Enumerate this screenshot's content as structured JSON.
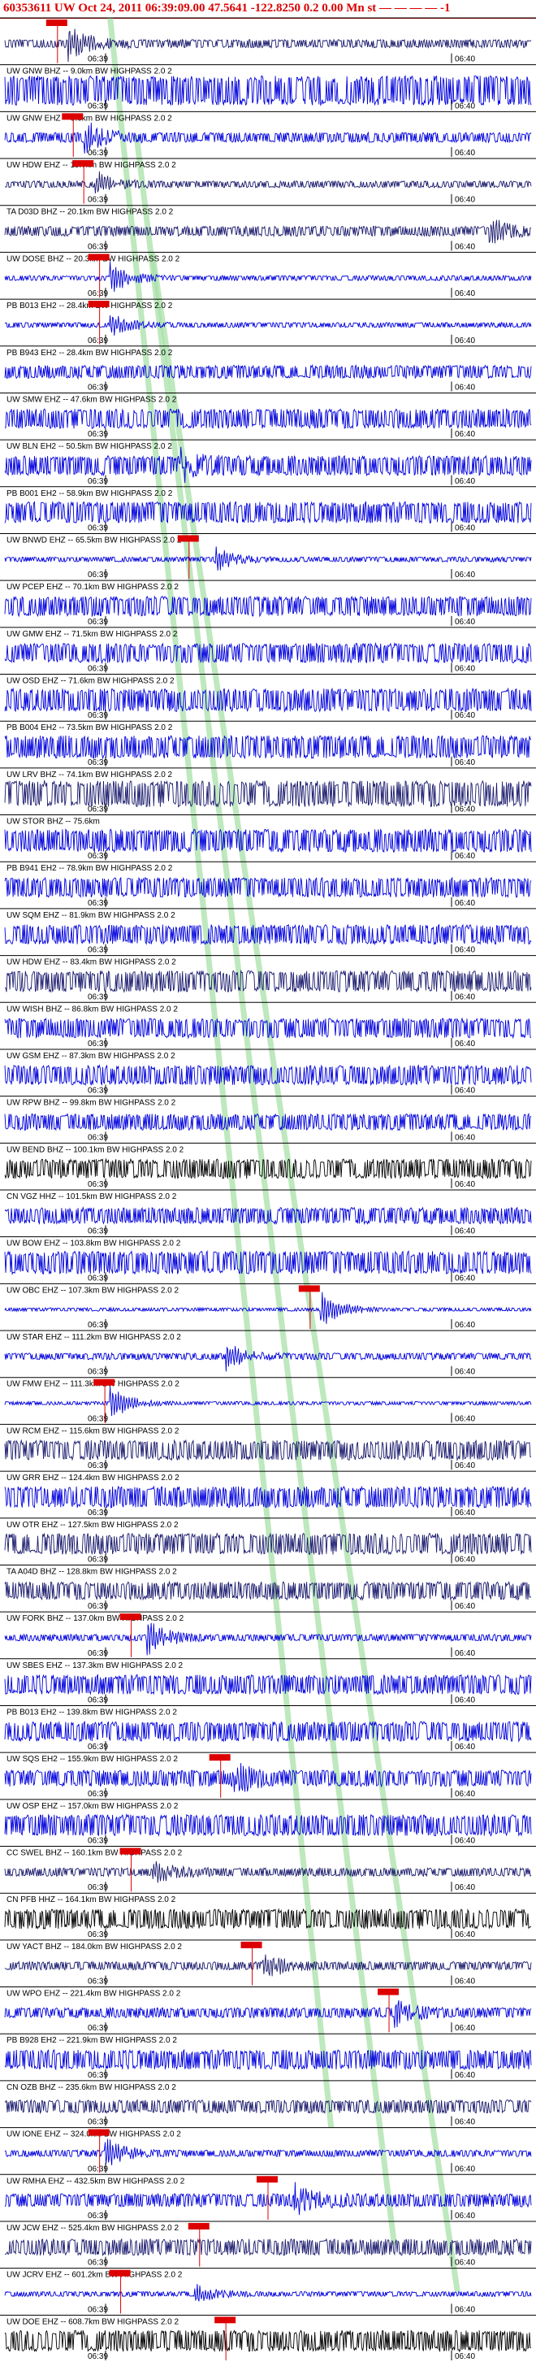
{
  "header": {
    "title": "60353611 UW Oct 24, 2011 06:39:09.00   47.5641 -122.8250   0.2 0.00 Mn st — — — — -1"
  },
  "time_labels": {
    "start": "06:39",
    "end": "06:40"
  },
  "colors": {
    "blue": "#0000dd",
    "navy": "#1a1a6e",
    "black": "#000000",
    "pick": "#dd0000",
    "phase": "#a8e0a8"
  },
  "stations": [
    {
      "label": "",
      "color": "navy",
      "amp": 5,
      "pick": 0.1,
      "event": 0.12,
      "evAmp": 20
    },
    {
      "label": "UW GNW BHZ -- 9.0km BW  HIGHPASS  2.0  2",
      "color": "blue",
      "amp": 18,
      "pick": null,
      "event": null,
      "evAmp": 0
    },
    {
      "label": "UW GNW EHZ -- 9.0km BW  HIGHPASS  2.0  2",
      "color": "blue",
      "amp": 6,
      "pick": 0.13,
      "event": 0.15,
      "evAmp": 18
    },
    {
      "label": "UW HDW EHZ -- 19.7km BW  HIGHPASS  2.0  2",
      "color": "navy",
      "amp": 4,
      "pick": 0.15,
      "event": 0.17,
      "evAmp": 16
    },
    {
      "label": "TA D03D BHZ -- 20.1km BW  HIGHPASS  2.0  2",
      "color": "navy",
      "amp": 6,
      "pick": null,
      "event": 0.92,
      "evAmp": 14
    },
    {
      "label": "UW DOSE BHZ -- 20.3km BW  HIGHPASS  2.0  2",
      "color": "blue",
      "amp": 3,
      "pick": 0.18,
      "event": 0.2,
      "evAmp": 18
    },
    {
      "label": "PB B013 EH2 -- 28.4km BW  HIGHPASS  2.0  2",
      "color": "blue",
      "amp": 3,
      "pick": 0.18,
      "event": 0.2,
      "evAmp": 14
    },
    {
      "label": "PB B943 EH2 -- 28.4km BW  HIGHPASS  2.0  2",
      "color": "blue",
      "amp": 8,
      "pick": null,
      "event": null,
      "evAmp": 0
    },
    {
      "label": "UW SMW EHZ -- 47.6km BW  HIGHPASS  2.0  2",
      "color": "blue",
      "amp": 12,
      "pick": null,
      "event": null,
      "evAmp": 0
    },
    {
      "label": "UW BLN EH2 -- 50.5km BW  HIGHPASS  2.0  2",
      "color": "blue",
      "amp": 12,
      "pick": null,
      "event": 0.33,
      "evAmp": 14
    },
    {
      "label": "PB B001 EH2 -- 58.9km BW  HIGHPASS  2.0  2",
      "color": "blue",
      "amp": 13,
      "pick": null,
      "event": null,
      "evAmp": 0
    },
    {
      "label": "UW BNWD EHZ -- 65.5km BW  HIGHPASS  2.0  2",
      "color": "blue",
      "amp": 3,
      "pick": 0.35,
      "event": 0.4,
      "evAmp": 14
    },
    {
      "label": "UW PCEP EHZ -- 70.1km BW  HIGHPASS  2.0  2",
      "color": "blue",
      "amp": 12,
      "pick": null,
      "event": null,
      "evAmp": 0
    },
    {
      "label": "UW GMW EHZ -- 71.5km BW  HIGHPASS  2.0  2",
      "color": "blue",
      "amp": 12,
      "pick": null,
      "event": null,
      "evAmp": 0
    },
    {
      "label": "UW OSD EHZ -- 71.6km BW  HIGHPASS  2.0  2",
      "color": "blue",
      "amp": 14,
      "pick": null,
      "event": null,
      "evAmp": 0
    },
    {
      "label": "PB B004 EH2 -- 73.5km BW  HIGHPASS  2.0  2",
      "color": "blue",
      "amp": 14,
      "pick": null,
      "event": null,
      "evAmp": 0
    },
    {
      "label": "UW LRV BHZ -- 74.1km BW  HIGHPASS  2.0  2",
      "color": "navy",
      "amp": 16,
      "pick": null,
      "event": null,
      "evAmp": 0
    },
    {
      "label": "UW STOR BHZ -- 75.6km",
      "color": "blue",
      "amp": 14,
      "pick": null,
      "event": null,
      "evAmp": 0
    },
    {
      "label": "PB B941 EH2 -- 78.9km BW  HIGHPASS  2.0  2",
      "color": "blue",
      "amp": 12,
      "pick": null,
      "event": null,
      "evAmp": 0
    },
    {
      "label": "UW SQM EHZ -- 81.9km BW  HIGHPASS  2.0  2",
      "color": "blue",
      "amp": 12,
      "pick": null,
      "event": null,
      "evAmp": 0
    },
    {
      "label": "UW HDW EHZ -- 83.4km BW  HIGHPASS  2.0  2",
      "color": "navy",
      "amp": 13,
      "pick": null,
      "event": null,
      "evAmp": 0
    },
    {
      "label": "UW WISH BHZ -- 86.8km BW  HIGHPASS  2.0  2",
      "color": "blue",
      "amp": 12,
      "pick": null,
      "event": null,
      "evAmp": 0
    },
    {
      "label": "UW GSM EHZ -- 87.3km BW  HIGHPASS  2.0  2",
      "color": "blue",
      "amp": 12,
      "pick": null,
      "event": null,
      "evAmp": 0
    },
    {
      "label": "UW RPW BHZ -- 99.8km BW  HIGHPASS  2.0  2",
      "color": "blue",
      "amp": 10,
      "pick": null,
      "event": null,
      "evAmp": 0
    },
    {
      "label": "UW BEND BHZ -- 100.1km BW  HIGHPASS  2.0  2",
      "color": "black",
      "amp": 12,
      "pick": null,
      "event": null,
      "evAmp": 0
    },
    {
      "label": "CN VGZ HHZ -- 101.5km BW  HIGHPASS  2.0  2",
      "color": "blue",
      "amp": 10,
      "pick": null,
      "event": null,
      "evAmp": 0
    },
    {
      "label": "UW BOW EHZ -- 103.8km BW  HIGHPASS  2.0  2",
      "color": "blue",
      "amp": 14,
      "pick": null,
      "event": null,
      "evAmp": 0
    },
    {
      "label": "UW OBC EHZ -- 107.3km BW  HIGHPASS  2.0  2",
      "color": "blue",
      "amp": 2,
      "pick": 0.58,
      "event": 0.6,
      "evAmp": 22
    },
    {
      "label": "UW STAR EHZ -- 111.2km BW  HIGHPASS  2.0  2",
      "color": "blue",
      "amp": 4,
      "pick": null,
      "event": 0.42,
      "evAmp": 18
    },
    {
      "label": "UW FMW EHZ -- 111.3km BW  HIGHPASS  2.0  2",
      "color": "blue",
      "amp": 2,
      "pick": 0.19,
      "event": 0.2,
      "evAmp": 20
    },
    {
      "label": "UW RCM EHZ -- 115.6km BW  HIGHPASS  2.0  2",
      "color": "navy",
      "amp": 12,
      "pick": null,
      "event": null,
      "evAmp": 0
    },
    {
      "label": "UW GRR EHZ -- 124.4km BW  HIGHPASS  2.0  2",
      "color": "blue",
      "amp": 13,
      "pick": null,
      "event": null,
      "evAmp": 0
    },
    {
      "label": "UW OTR EHZ -- 127.5km BW  HIGHPASS  2.0  2",
      "color": "navy",
      "amp": 13,
      "pick": null,
      "event": null,
      "evAmp": 0
    },
    {
      "label": "TA A04D BHZ -- 128.8km BW  HIGHPASS  2.0  2",
      "color": "navy",
      "amp": 11,
      "pick": null,
      "event": null,
      "evAmp": 0
    },
    {
      "label": "UW FORK BHZ -- 137.0km BW  HIGHPASS  2.0  2",
      "color": "blue",
      "amp": 4,
      "pick": 0.24,
      "event": 0.27,
      "evAmp": 20
    },
    {
      "label": "UW SBES EHZ -- 137.3km BW  HIGHPASS  2.0  2",
      "color": "blue",
      "amp": 12,
      "pick": null,
      "event": null,
      "evAmp": 0
    },
    {
      "label": "PB B013 EH2 -- 139.8km BW  HIGHPASS  2.0  2",
      "color": "blue",
      "amp": 12,
      "pick": null,
      "event": null,
      "evAmp": 0
    },
    {
      "label": "UW SQS EH2 -- 155.9km BW  HIGHPASS  2.0  2",
      "color": "blue",
      "amp": 10,
      "pick": 0.41,
      "event": 0.43,
      "evAmp": 16
    },
    {
      "label": "UW OSP EHZ -- 157.0km BW  HIGHPASS  2.0  2",
      "color": "blue",
      "amp": 13,
      "pick": null,
      "event": null,
      "evAmp": 0
    },
    {
      "label": "CC SWEL BHZ -- 160.1km BW  HIGHPASS  2.0  2",
      "color": "navy",
      "amp": 5,
      "pick": 0.24,
      "event": 0.28,
      "evAmp": 14
    },
    {
      "label": "CN PFB HHZ -- 164.1km BW  HIGHPASS  2.0  2",
      "color": "black",
      "amp": 12,
      "pick": null,
      "event": null,
      "evAmp": 0
    },
    {
      "label": "UW YACT BHZ -- 184.0km BW  HIGHPASS  2.0  2",
      "color": "navy",
      "amp": 5,
      "pick": 0.47,
      "event": 0.49,
      "evAmp": 16
    },
    {
      "label": "UW WPO EHZ -- 221.4km BW  HIGHPASS  2.0  2",
      "color": "blue",
      "amp": 6,
      "pick": 0.73,
      "event": 0.74,
      "evAmp": 16
    },
    {
      "label": "PB B928 EH2 -- 221.9km BW  HIGHPASS  2.0  2",
      "color": "blue",
      "amp": 12,
      "pick": null,
      "event": null,
      "evAmp": 0
    },
    {
      "label": "CN OZB BHZ -- 235.6km BW  HIGHPASS  2.0  2",
      "color": "navy",
      "amp": 8,
      "pick": null,
      "event": null,
      "evAmp": 0
    },
    {
      "label": "UW IONE EHZ -- 324.0km BW  HIGHPASS  2.0  2",
      "color": "blue",
      "amp": 4,
      "pick": 0.18,
      "event": 0.19,
      "evAmp": 18
    },
    {
      "label": "UW RMHA EHZ -- 432.5km BW  HIGHPASS  2.0  2",
      "color": "blue",
      "amp": 8,
      "pick": 0.5,
      "event": 0.55,
      "evAmp": 16
    },
    {
      "label": "UW JCW EHZ -- 525.4km BW  HIGHPASS  2.0  2",
      "color": "navy",
      "amp": 10,
      "pick": 0.37,
      "event": null,
      "evAmp": 0
    },
    {
      "label": "UW JCRV EHZ -- 601.2km BW  HIGHPASS  2.0  2",
      "color": "blue",
      "amp": 3,
      "pick": 0.22,
      "event": 0.36,
      "evAmp": 12
    },
    {
      "label": "UW DOE EHZ -- 608.7km BW  HIGHPASS  2.0  2",
      "color": "black",
      "amp": 13,
      "pick": 0.42,
      "event": null,
      "evAmp": 0
    }
  ]
}
